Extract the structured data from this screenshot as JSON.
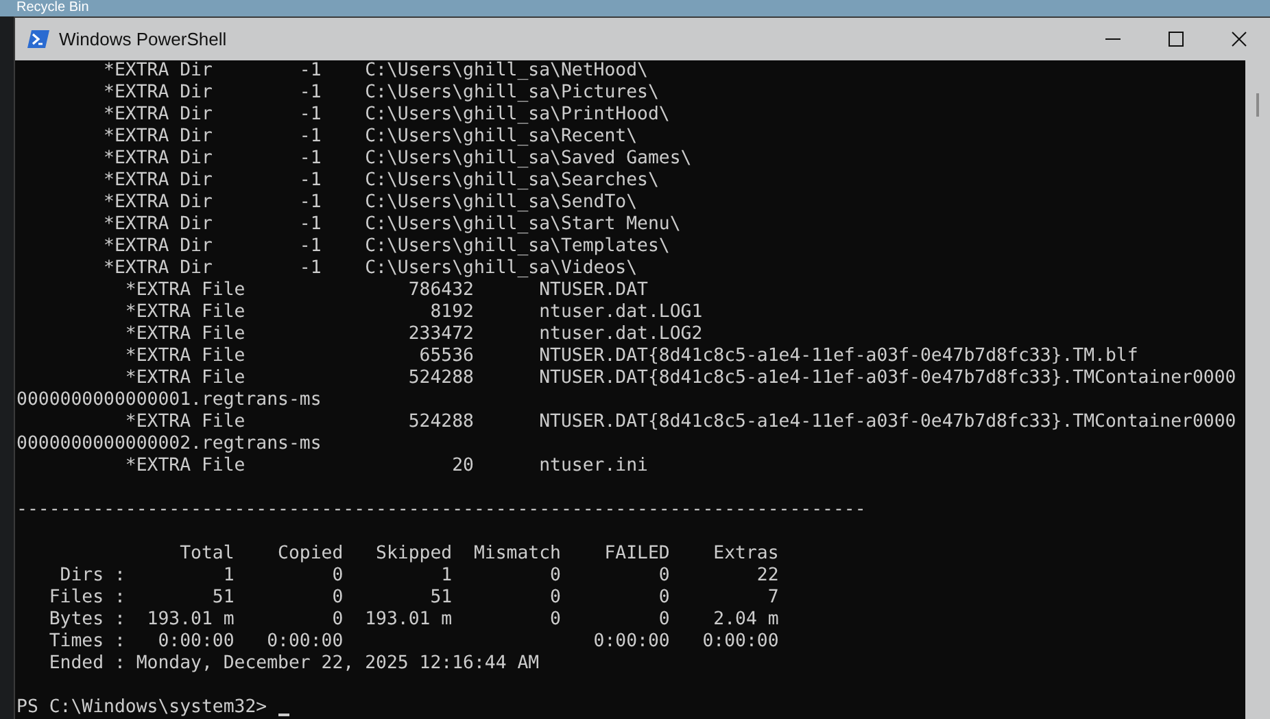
{
  "desktop": {
    "icon_label": "Recycle Bin"
  },
  "window": {
    "title": "Windows PowerShell"
  },
  "console": {
    "listing": [
      "        *EXTRA Dir        -1    C:\\Users\\ghill_sa\\NetHood\\",
      "        *EXTRA Dir        -1    C:\\Users\\ghill_sa\\Pictures\\",
      "        *EXTRA Dir        -1    C:\\Users\\ghill_sa\\PrintHood\\",
      "        *EXTRA Dir        -1    C:\\Users\\ghill_sa\\Recent\\",
      "        *EXTRA Dir        -1    C:\\Users\\ghill_sa\\Saved Games\\",
      "        *EXTRA Dir        -1    C:\\Users\\ghill_sa\\Searches\\",
      "        *EXTRA Dir        -1    C:\\Users\\ghill_sa\\SendTo\\",
      "        *EXTRA Dir        -1    C:\\Users\\ghill_sa\\Start Menu\\",
      "        *EXTRA Dir        -1    C:\\Users\\ghill_sa\\Templates\\",
      "        *EXTRA Dir        -1    C:\\Users\\ghill_sa\\Videos\\",
      "          *EXTRA File               786432      NTUSER.DAT",
      "          *EXTRA File                 8192      ntuser.dat.LOG1",
      "          *EXTRA File               233472      ntuser.dat.LOG2",
      "          *EXTRA File                65536      NTUSER.DAT{8d41c8c5-a1e4-11ef-a03f-0e47b7d8fc33}.TM.blf",
      "          *EXTRA File               524288      NTUSER.DAT{8d41c8c5-a1e4-11ef-a03f-0e47b7d8fc33}.TMContainer0000",
      "0000000000000001.regtrans-ms",
      "          *EXTRA File               524288      NTUSER.DAT{8d41c8c5-a1e4-11ef-a03f-0e47b7d8fc33}.TMContainer0000",
      "0000000000000002.regtrans-ms",
      "          *EXTRA File                   20      ntuser.ini"
    ],
    "rule": "------------------------------------------------------------------------------",
    "summary": [
      "               Total    Copied   Skipped  Mismatch    FAILED    Extras",
      "    Dirs :         1         0         1         0         0        22",
      "   Files :        51         0        51         0         0         7",
      "   Bytes :  193.01 m         0  193.01 m         0         0    2.04 m",
      "   Times :   0:00:00   0:00:00                       0:00:00   0:00:00",
      "   Ended : Monday, December 22, 2025 12:16:44 AM"
    ],
    "prompt": "PS C:\\Windows\\system32> "
  }
}
